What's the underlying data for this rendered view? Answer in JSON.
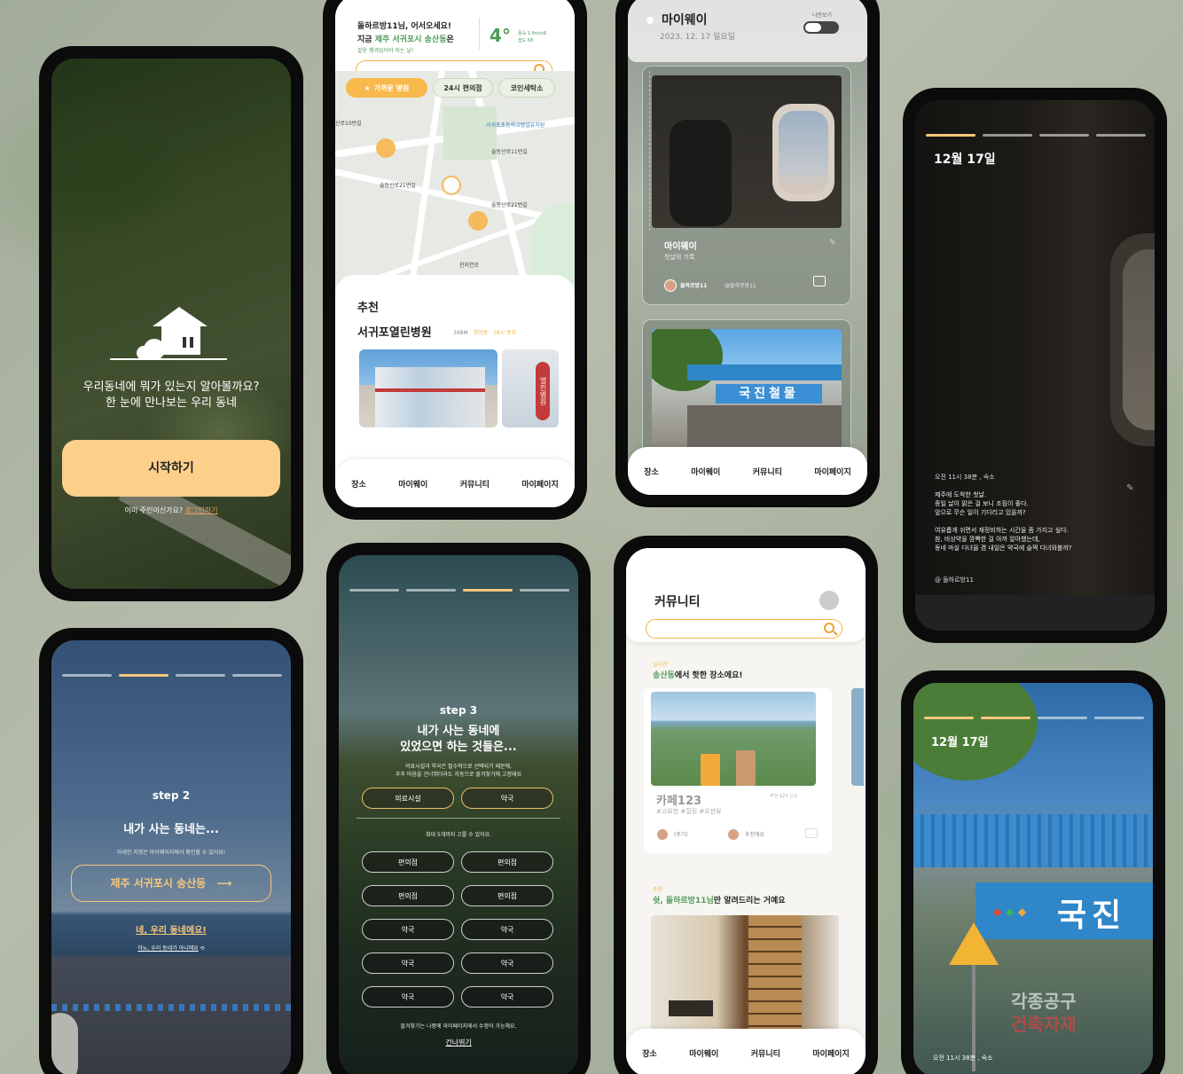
{
  "colors": {
    "accent": "#f8c77d",
    "accent_dark": "#f3b54a",
    "green": "#4e9a58"
  },
  "onboarding": {
    "headline_line1": "우리동네에 뭐가 있는지 알아볼까요?",
    "headline_line2": "한 눈에 만나보는 우리 동네",
    "start_button": "시작하기",
    "login_prompt": "이미 주인이신가요?",
    "login_link": "로그인하기"
  },
  "map_screen": {
    "greeting": "돌하르방11님, 어서오세요!",
    "location_prefix": "지금 ",
    "location_name": "제주 서귀포시 송산동",
    "location_suffix": "은",
    "weather_note": "겉옷 챙겨입어야 하는 날!",
    "temperature": "4°",
    "weather_detail1": "풍속 1.9m/s로",
    "weather_detail2": "습도 68",
    "chips": [
      "가까운 병원",
      "24시 편의점",
      "코인세탁소"
    ],
    "map_labels": [
      "산로10번길",
      "서귀포초등학교병설유치원",
      "솔동산로11번길",
      "솔동산로21번길",
      "솔동산로21번길",
      "천지연로",
      "천지동",
      "솔동",
      "부두로",
      "천지연로"
    ],
    "section_title": "추천",
    "place_name": "서귀포열린병원",
    "place_distance": "398M",
    "place_status": "영업중",
    "place_close": "18시 종료",
    "sign_text": "열린병원"
  },
  "nav": [
    "장소",
    "마이웨이",
    "커뮤니티",
    "마이페이지"
  ],
  "myway": {
    "title": "마이웨이",
    "date": "2023. 12. 17 일요일",
    "toggle_label": "나만보기",
    "card_title": "마이웨이",
    "card_sub": "첫날의 기록",
    "user": "돌하르방11",
    "handle": "@돌하르방11",
    "sign_text": "국진철물"
  },
  "story1": {
    "date": "12월 17일",
    "meta": "오전 11시 38분 , 숙소",
    "body1": "제주에 도착한 첫날.",
    "body2": "종일 날이 맑은 걸 보니 조짐이 좋다.",
    "body3": "앞으로 무슨 일이 기다리고 있을까?",
    "body4": "여유롭게 쉬면서 재정비하는 시간을 좀 가지고 싶다.",
    "body5": "참, 비상약을 깜빡한 걸 아까 알아챘는데,",
    "body6": "동네 마실 다녀올 겸 내일은 약국에 슬쩍 다녀와볼까?",
    "handle": "@ 돌하르방11"
  },
  "step2": {
    "step": "step 2",
    "title": "내가 사는 동네는...",
    "hint": "자세한 지명은 마이페이지에서 확인할 수 있어요!",
    "location_button": "제주 서귀포시 송산동",
    "confirm": "네, 우리 동네에요!",
    "deny": "아뇨, 우리 동네가 아니에요"
  },
  "step3": {
    "step": "step 3",
    "title1": "내가 사는 동네에",
    "title2": "있었으면 하는 것들은...",
    "desc1": "의료시설과 약국은 필수적으로 선택되기 때문에,",
    "desc2": "추후 마음을 건너뛰더라도 자동으로 즐겨찾기에 고정돼요",
    "fixed": [
      "의료시설",
      "약국"
    ],
    "limit": "최대 5개까지 고를 수 있어요.",
    "options": [
      "편의점",
      "편의점",
      "편의점",
      "편의점",
      "약국",
      "약국",
      "약국",
      "약국",
      "약국",
      "약국"
    ],
    "footer": "즐겨찾기는 나중에 마이페이지에서 수정이 가능해요.",
    "skip": "건너뛰기"
  },
  "community": {
    "title": "커뮤니티",
    "realtime_label": "실시간",
    "realtime_place": "송산동",
    "realtime_suffix": "에서 핫한 장소에요!",
    "cafe_name": "카페123",
    "cafe_meta": "추천 123 신고",
    "cafe_tags": "#고요한 #힐링 #오션뷰",
    "review_label": "(후기)",
    "recommend_label": "추천해요",
    "rec_label": "추천",
    "rec_title_prefix": "쉿, ",
    "rec_title_name": "돌하르방11님",
    "rec_title_suffix": "만 알려드리는 거예요"
  },
  "story2": {
    "date": "12월 17일",
    "sign_text": "국진",
    "sign2": "각종공구",
    "sign3": "건축자재",
    "meta": "오전 11시 38분 , 숙소"
  }
}
